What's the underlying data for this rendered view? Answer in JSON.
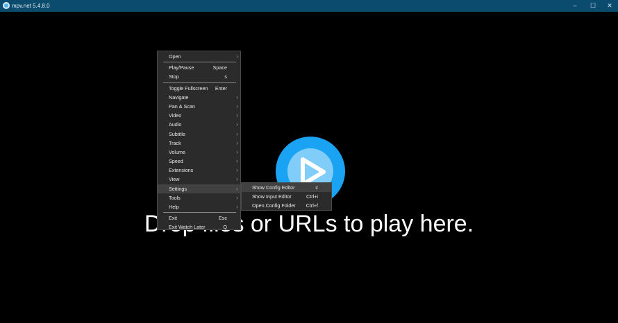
{
  "window": {
    "title": "mpv.net 5.4.8.0",
    "minimize": "–",
    "maximize": "☐",
    "close": "✕"
  },
  "main": {
    "drop_text": "Drop files or URLs to play here."
  },
  "colors": {
    "titlebar": "#0a4b6e",
    "logo_outer": "#1aa3f2",
    "logo_inner": "#80cdfa"
  },
  "menu": {
    "groups": [
      [
        {
          "label": "Open",
          "submenu": true
        }
      ],
      [
        {
          "label": "Play/Pause",
          "shortcut": "Space"
        },
        {
          "label": "Stop",
          "shortcut": "s"
        }
      ],
      [
        {
          "label": "Toggle Fullscreen",
          "shortcut": "Enter"
        },
        {
          "label": "Navigate",
          "submenu": true
        },
        {
          "label": "Pan & Scan",
          "submenu": true
        },
        {
          "label": "Video",
          "submenu": true
        },
        {
          "label": "Audio",
          "submenu": true
        },
        {
          "label": "Subtitle",
          "submenu": true
        },
        {
          "label": "Track",
          "submenu": true
        },
        {
          "label": "Volume",
          "submenu": true
        },
        {
          "label": "Speed",
          "submenu": true
        },
        {
          "label": "Extensions",
          "submenu": true
        },
        {
          "label": "View",
          "submenu": true
        },
        {
          "label": "Settings",
          "submenu": true,
          "highlighted": true
        },
        {
          "label": "Tools",
          "submenu": true
        },
        {
          "label": "Help",
          "submenu": true
        }
      ],
      [
        {
          "label": "Exit",
          "shortcut": "Esc"
        },
        {
          "label": "Exit Watch Later",
          "shortcut": "Q"
        }
      ]
    ]
  },
  "submenu": {
    "items": [
      {
        "label": "Show Config Editor",
        "shortcut": "c",
        "highlighted": true
      },
      {
        "label": "Show Input Editor",
        "shortcut": "Ctrl+i"
      },
      {
        "label": "Open Config Folder",
        "shortcut": "Ctrl+f"
      }
    ]
  }
}
